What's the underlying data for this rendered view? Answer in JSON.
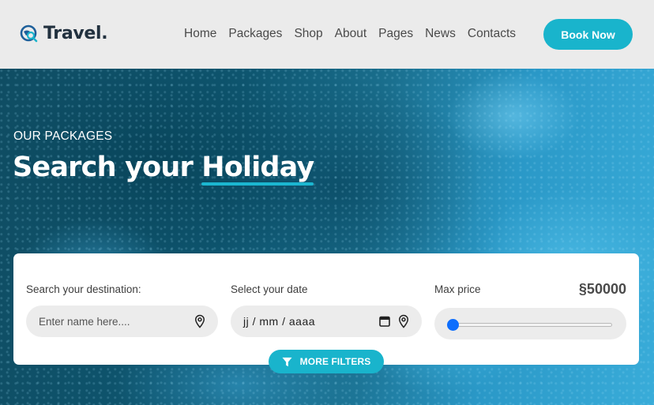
{
  "brand": {
    "name": "Travel."
  },
  "nav": {
    "items": [
      {
        "label": "Home"
      },
      {
        "label": "Packages"
      },
      {
        "label": "Shop"
      },
      {
        "label": "About"
      },
      {
        "label": "Pages"
      },
      {
        "label": "News"
      },
      {
        "label": "Contacts"
      }
    ],
    "cta_label": "Book Now"
  },
  "hero": {
    "eyebrow": "OUR PACKAGES",
    "title_prefix": "Search your ",
    "title_accent": "Holiday"
  },
  "search": {
    "destination_label": "Search your destination:",
    "destination_placeholder": "Enter name here....",
    "date_label": "Select your date",
    "date_value": "jj / mm / aaaa",
    "price_label": "Max price",
    "price_value": "§50000",
    "price_slider_fraction": 0.0,
    "more_filters_label": "MORE FILTERS"
  },
  "colors": {
    "accent": "#19b4cc",
    "slider_thumb": "#0d6efd",
    "header_bg": "#ebebeb"
  }
}
